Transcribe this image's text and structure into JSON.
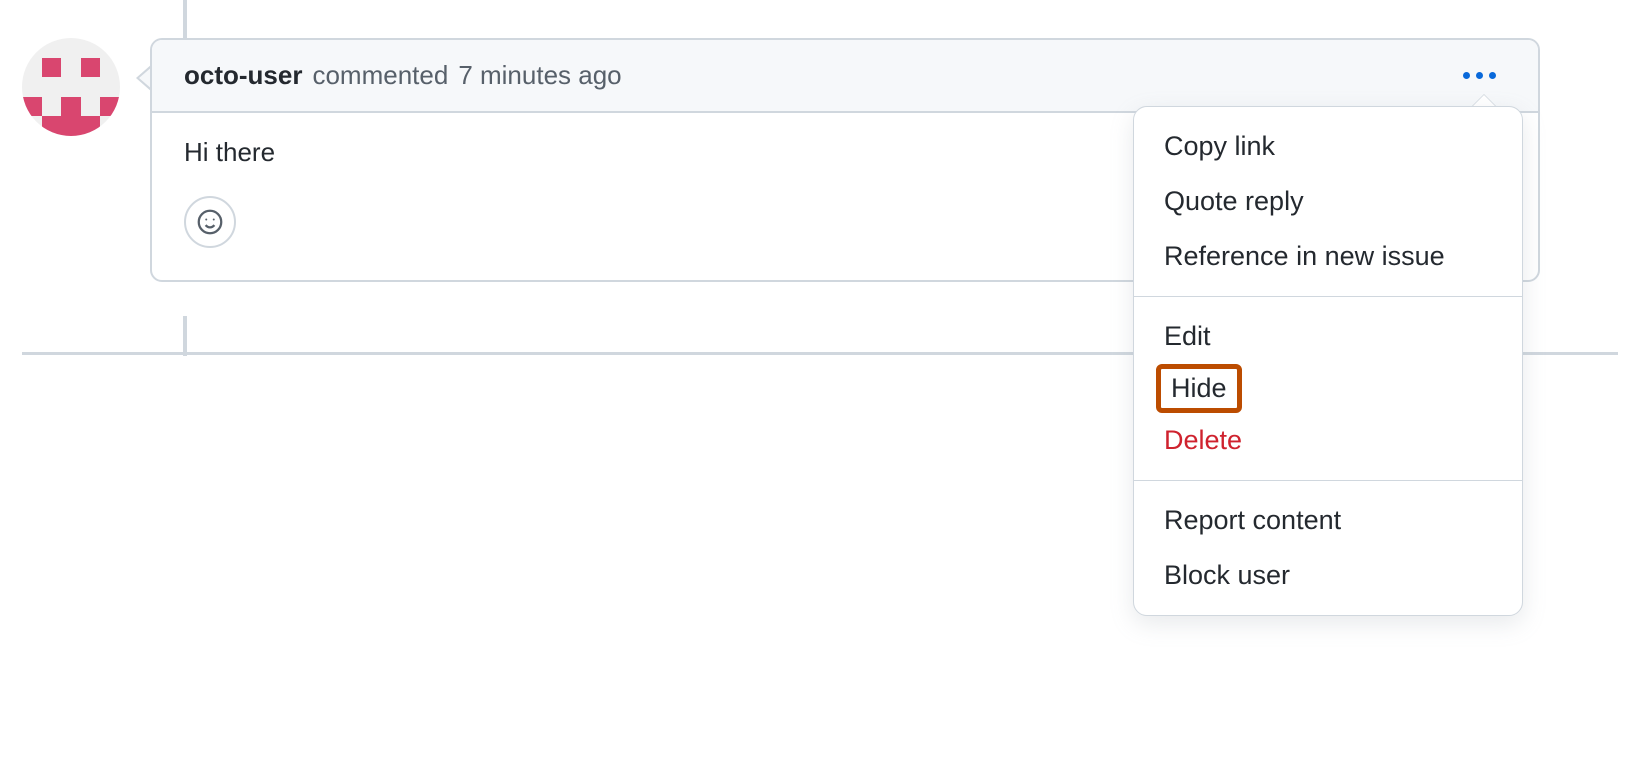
{
  "comment": {
    "author": "octo-user",
    "action_label": "commented",
    "timestamp": "7 minutes ago",
    "body": "Hi there"
  },
  "menu": {
    "group1": [
      {
        "label": "Copy link"
      },
      {
        "label": "Quote reply"
      },
      {
        "label": "Reference in new issue"
      }
    ],
    "group2": [
      {
        "label": "Edit"
      },
      {
        "label": "Hide",
        "highlight": true
      },
      {
        "label": "Delete",
        "danger": true
      }
    ],
    "group3": [
      {
        "label": "Report content"
      },
      {
        "label": "Block user"
      }
    ]
  }
}
